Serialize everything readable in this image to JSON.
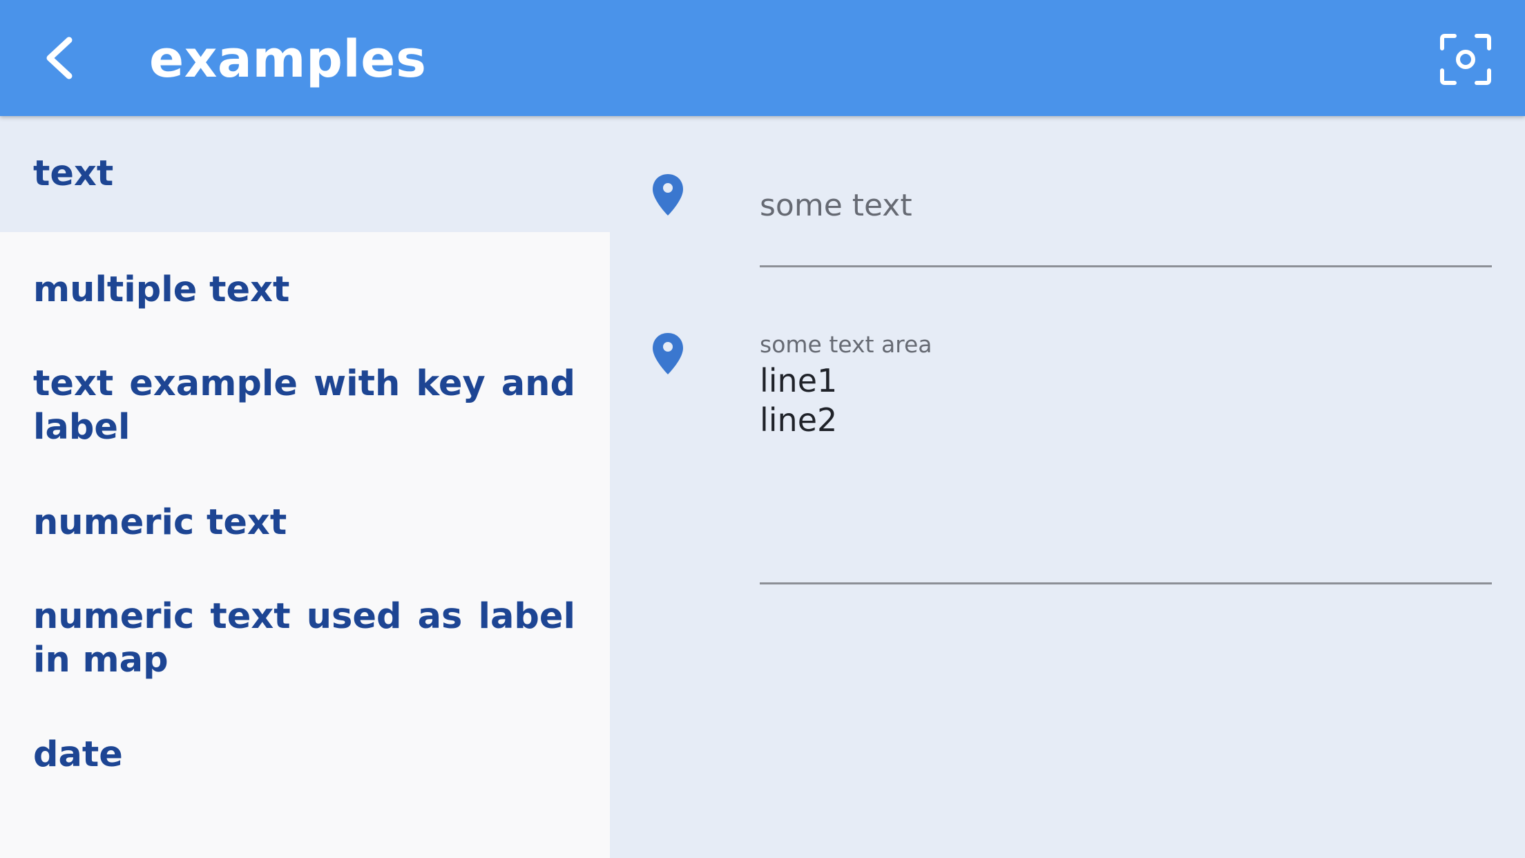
{
  "appbar": {
    "title": "examples",
    "back_icon": "arrow-back-icon",
    "scan_icon": "scan-focus-icon",
    "color": "#4a93ea"
  },
  "sidebar": {
    "items": [
      {
        "label": "text",
        "selected": true
      },
      {
        "label": "multiple text",
        "selected": false
      },
      {
        "label": "text example with key and label",
        "selected": false
      },
      {
        "label": "numeric text",
        "selected": false
      },
      {
        "label": "numeric text used as label in map",
        "selected": false
      },
      {
        "label": "date",
        "selected": false
      }
    ]
  },
  "form": {
    "text_field": {
      "icon": "location-pin-icon",
      "placeholder": "some text",
      "value": ""
    },
    "text_area": {
      "icon": "location-pin-icon",
      "label": "some text area",
      "line1": "line1",
      "line2": "line2"
    }
  },
  "colors": {
    "accent": "#4a93ea",
    "item_text": "#1d4593",
    "pin": "#3a77cf",
    "background": "#e6ecf6"
  }
}
